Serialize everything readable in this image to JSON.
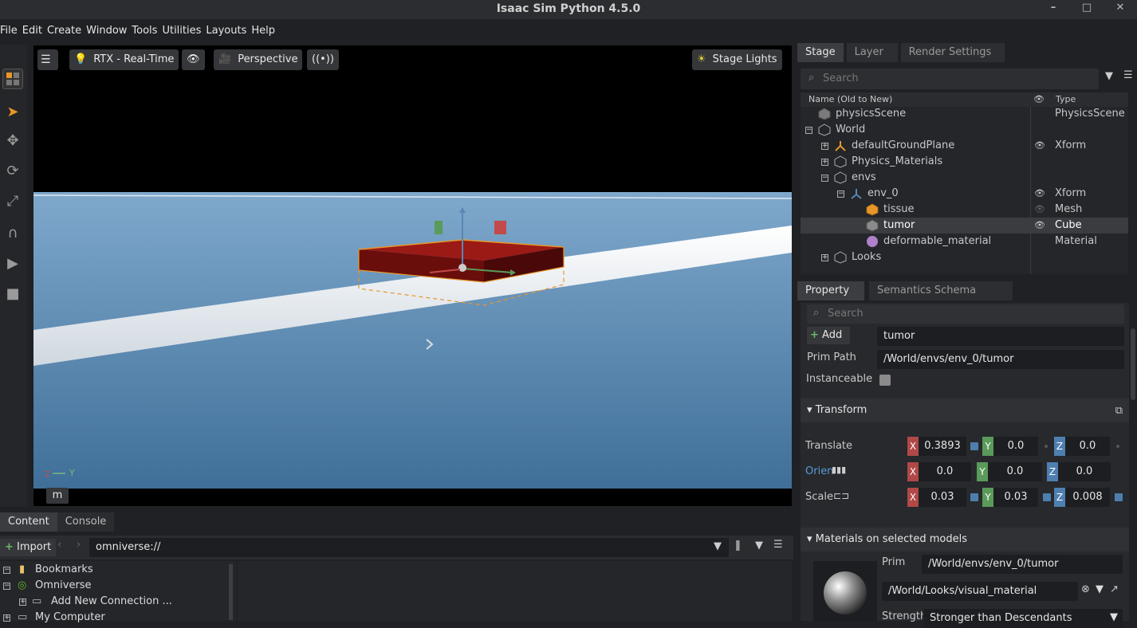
{
  "window": {
    "title": "Isaac Sim Python 4.5.0",
    "controls": [
      "–",
      "□",
      "✕"
    ]
  },
  "menu": [
    "File",
    "Edit",
    "Create",
    "Window",
    "Tools",
    "Utilities",
    "Layouts",
    "Help"
  ],
  "viewport": {
    "renderer": "RTX - Real-Time",
    "camera": "Perspective",
    "stage_lights": "Stage Lights",
    "corner_label": "m",
    "axis_label": "Y"
  },
  "content": {
    "tabs": [
      "Content",
      "Console"
    ],
    "import_label": "Import",
    "path": "omniverse://",
    "tree": [
      "Bookmarks",
      "Omniverse",
      "Add New Connection ...",
      "My Computer"
    ]
  },
  "stage": {
    "tabs": [
      "Stage",
      "Layer",
      "Render Settings"
    ],
    "search_placeholder": "Search",
    "col_name": "Name (Old to New)",
    "col_type": "Type",
    "rows": [
      {
        "name": "physicsScene",
        "type": "PhysicsScene"
      },
      {
        "name": "World",
        "type": ""
      },
      {
        "name": "defaultGroundPlane",
        "type": "Xform"
      },
      {
        "name": "Physics_Materials",
        "type": ""
      },
      {
        "name": "envs",
        "type": ""
      },
      {
        "name": "env_0",
        "type": "Xform"
      },
      {
        "name": "tissue",
        "type": "Mesh"
      },
      {
        "name": "tumor",
        "type": "Cube"
      },
      {
        "name": "deformable_material",
        "type": "Material"
      },
      {
        "name": "Looks",
        "type": ""
      }
    ]
  },
  "property": {
    "tabs": [
      "Property",
      "Semantics Schema Editor"
    ],
    "search_placeholder": "Search",
    "add_label": "Add",
    "prim_name": "tumor",
    "prim_path_label": "Prim Path",
    "prim_path": "/World/envs/env_0/tumor",
    "instanceable_label": "Instanceable",
    "transform_label": "Transform",
    "translate_label": "Translate",
    "orient_label": "Orien",
    "scale_label": "Scale",
    "translate": [
      "0.3893",
      "0.0",
      "0.0"
    ],
    "orient": [
      "0.0",
      "0.0",
      "0.0"
    ],
    "scale": [
      "0.03",
      "0.03",
      "0.008"
    ],
    "axis_letters": [
      "X",
      "Y",
      "Z"
    ],
    "materials_label": "Materials on selected models",
    "mat_prim_label": "Prim",
    "mat_prim": "/World/envs/env_0/tumor",
    "material": "/World/Looks/visual_material",
    "strength_label": "Strength",
    "strength": "Stronger than Descendants"
  }
}
